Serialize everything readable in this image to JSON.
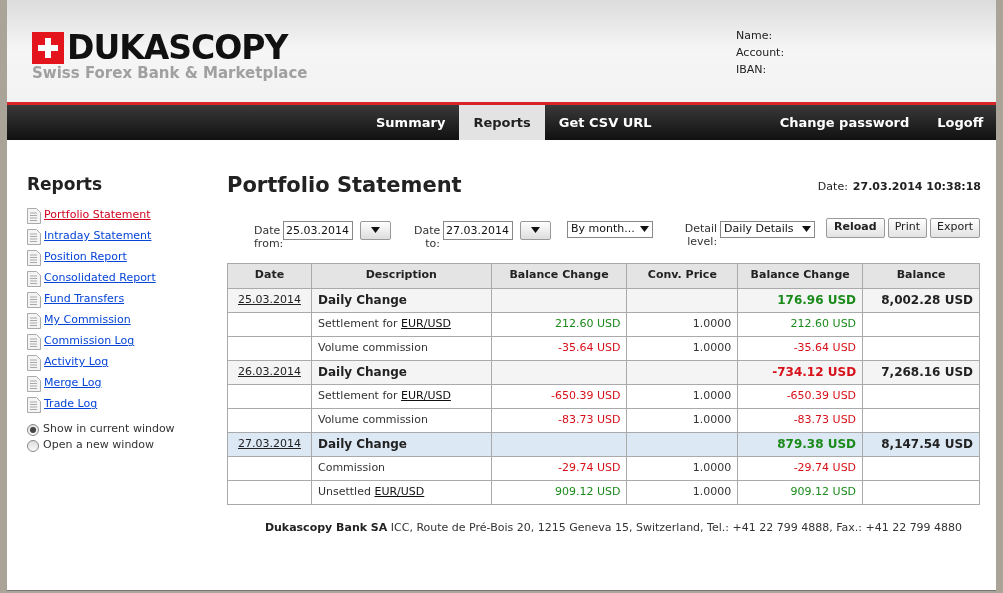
{
  "logo": {
    "brand": "DUKASCOPY",
    "tagline": "Swiss Forex Bank & Marketplace"
  },
  "account_info": [
    "Name:",
    "Account:",
    "IBAN:"
  ],
  "nav": [
    {
      "label": "Summary",
      "selected": false
    },
    {
      "label": "Reports",
      "selected": true
    },
    {
      "label": "Get CSV URL",
      "selected": false
    },
    {
      "label": "Change password",
      "selected": false
    },
    {
      "label": "Logoff",
      "selected": false
    }
  ],
  "sidebar": {
    "title": "Reports",
    "items": [
      {
        "label": "Portfolio Statement",
        "selected": true
      },
      {
        "label": "Intraday Statement",
        "selected": false
      },
      {
        "label": "Position Report",
        "selected": false
      },
      {
        "label": "Consolidated Report",
        "selected": false
      },
      {
        "label": "Fund Transfers",
        "selected": false
      },
      {
        "label": "My Commission",
        "selected": false
      },
      {
        "label": "Commission Log",
        "selected": false
      },
      {
        "label": "Activity Log",
        "selected": false
      },
      {
        "label": "Merge Log",
        "selected": false
      },
      {
        "label": "Trade Log",
        "selected": false
      }
    ],
    "window_options": [
      {
        "label": "Show in current window",
        "selected": true
      },
      {
        "label": "Open a new window",
        "selected": false
      }
    ]
  },
  "page_title": "Portfolio Statement",
  "report_date": {
    "label": "Date:",
    "value": "27.03.2014 10:38:18"
  },
  "filters": {
    "date_from": {
      "label": "Date from:",
      "value": "25.03.2014"
    },
    "date_to": {
      "label": "Date to:",
      "value": "27.03.2014"
    },
    "period": "By month...",
    "detail_level": {
      "label": "Detail level:",
      "value": "Daily Details"
    }
  },
  "buttons": [
    "Reload",
    "Print",
    "Export"
  ],
  "table": {
    "columns": [
      "Date",
      "Description",
      "Balance Change",
      "Conv. Price",
      "Balance Change",
      "Balance"
    ],
    "rows": [
      {
        "kind": "daily",
        "selected": false,
        "date": "25.03.2014",
        "description": "Daily Change",
        "change_total": "176.96 USD",
        "color": "#1a8a1a",
        "balance": "8,002.28 USD"
      },
      {
        "kind": "detail",
        "description": "Settlement for",
        "pair": "EUR/USD",
        "change": "212.60 USD",
        "conv_price": "1.0000",
        "change_total": "212.60 USD",
        "color": "#1a8a1a"
      },
      {
        "kind": "detail",
        "description": "Volume commission",
        "change": "-35.64 USD",
        "conv_price": "1.0000",
        "change_total": "-35.64 USD",
        "color": "#d8101a"
      },
      {
        "kind": "daily",
        "selected": false,
        "date": "26.03.2014",
        "description": "Daily Change",
        "change_total": "-734.12 USD",
        "color": "#d8101a",
        "balance": "7,268.16 USD"
      },
      {
        "kind": "detail",
        "description": "Settlement for",
        "pair": "EUR/USD",
        "change": "-650.39 USD",
        "conv_price": "1.0000",
        "change_total": "-650.39 USD",
        "color": "#d8101a"
      },
      {
        "kind": "detail",
        "description": "Volume commission",
        "change": "-83.73 USD",
        "conv_price": "1.0000",
        "change_total": "-83.73 USD",
        "color": "#d8101a"
      },
      {
        "kind": "daily",
        "selected": true,
        "date": "27.03.2014",
        "description": "Daily Change",
        "change_total": "879.38 USD",
        "color": "#1a8a1a",
        "balance": "8,147.54 USD"
      },
      {
        "kind": "detail",
        "description": "Commission",
        "change": "-29.74 USD",
        "conv_price": "1.0000",
        "change_total": "-29.74 USD",
        "color": "#d8101a"
      },
      {
        "kind": "detail",
        "description": "Unsettled",
        "pair": "EUR/USD",
        "change": "909.12 USD",
        "conv_price": "1.0000",
        "change_total": "909.12 USD",
        "color": "#1a8a1a"
      }
    ]
  },
  "footer": {
    "company": "Dukascopy Bank SA",
    "address": "ICC, Route de Pré-Bois 20, 1215 Geneva 15, Switzerland, Tel.: +41 22 799 4888, Fax.: +41 22 799 4880"
  }
}
